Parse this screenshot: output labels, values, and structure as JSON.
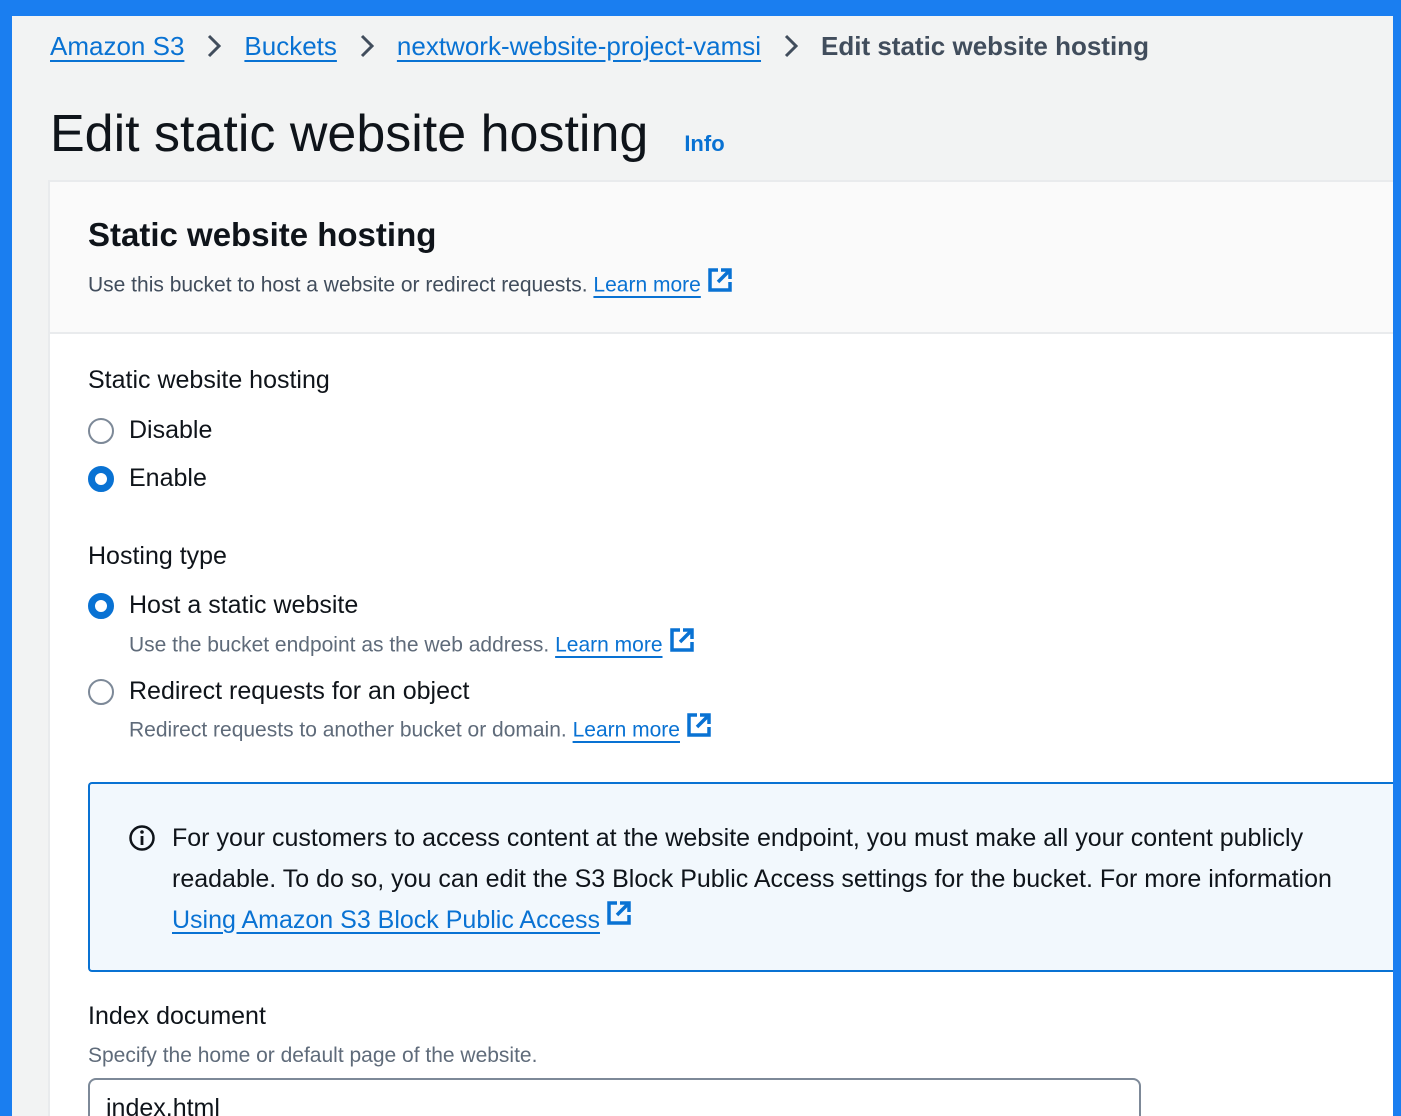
{
  "breadcrumb": {
    "items": [
      "Amazon S3",
      "Buckets",
      "nextwork-website-project-vamsi"
    ],
    "current": "Edit static website hosting"
  },
  "page": {
    "title": "Edit static website hosting",
    "info_label": "Info"
  },
  "panel": {
    "title": "Static website hosting",
    "description": "Use this bucket to host a website or redirect requests.",
    "learn_more": "Learn more"
  },
  "hosting_toggle": {
    "label": "Static website hosting",
    "options": [
      {
        "label": "Disable",
        "checked": false
      },
      {
        "label": "Enable",
        "checked": true
      }
    ]
  },
  "hosting_type": {
    "label": "Hosting type",
    "options": [
      {
        "label": "Host a static website",
        "description": "Use the bucket endpoint as the web address.",
        "learn_more": "Learn more",
        "checked": true
      },
      {
        "label": "Redirect requests for an object",
        "description": "Redirect requests to another bucket or domain.",
        "learn_more": "Learn more",
        "checked": false
      }
    ]
  },
  "alert": {
    "line1": "For your customers to access content at the website endpoint, you must make all your content publicly",
    "line2": "readable. To do so, you can edit the S3 Block Public Access settings for the bucket. For more information",
    "link": "Using Amazon S3 Block Public Access"
  },
  "index_document": {
    "label": "Index document",
    "helper": "Specify the home or default page of the website.",
    "value": "index.html"
  },
  "colors": {
    "background": "#1a7ef0",
    "link": "#0972d3",
    "alert_bg": "#f2f8fd"
  }
}
